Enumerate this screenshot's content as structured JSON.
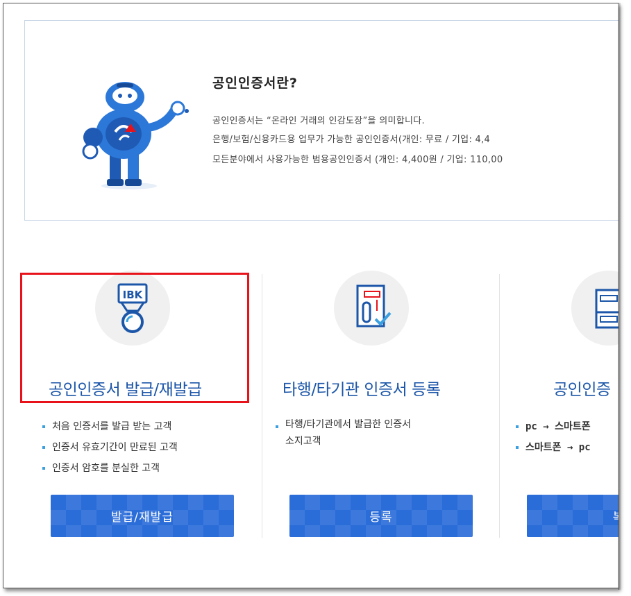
{
  "intro": {
    "title": "공인인증서란?",
    "lines": [
      "공인인증서는 “온라인 거래의 인감도장”을 의미합니다.",
      "은행/보험/신용카드용 업무가 가능한 공인인증서(개인: 무료 / 기업: 4,4",
      "모든분야에서 사용가능한 범용공인인증서 (개인: 4,400원 / 기업: 110,00"
    ]
  },
  "cards": [
    {
      "title": "공인인증서 발급/재발급",
      "bullets": [
        "처음 인증서를 발급 받는 고객",
        "인증서 유효기간이 만료된 고객",
        "인증서 암호를 분실한 고객"
      ],
      "button": "발급/재발급",
      "badge": "IBK"
    },
    {
      "title": "타행/타기관 인증서 등록",
      "bullets": [
        "타행/타기관에서 발급한 인증서",
        "소지고객"
      ],
      "button": "등록"
    },
    {
      "title": "공인인증",
      "bullets": [
        "pc → 스마트폰",
        "스마트폰 → pc"
      ],
      "button": "복"
    }
  ],
  "colors": {
    "accent": "#1c56a8",
    "button": "#2a6cd8",
    "highlight": "#e8121b",
    "bullet": "#3aa0e0"
  }
}
